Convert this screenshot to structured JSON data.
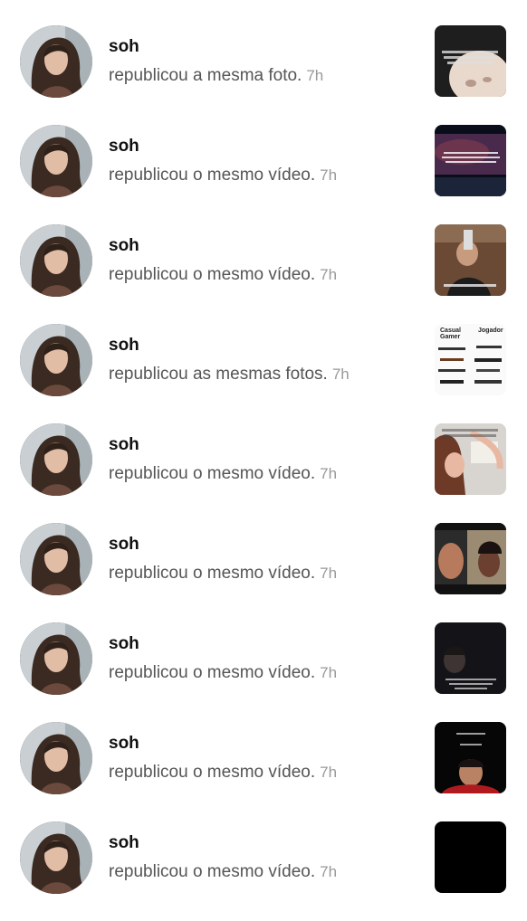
{
  "notifications": [
    {
      "username": "soh",
      "action": "republicou a mesma foto.",
      "time": "7h",
      "thumb": "baby-face"
    },
    {
      "username": "soh",
      "action": "republicou o mesmo vídeo.",
      "time": "7h",
      "thumb": "space-night"
    },
    {
      "username": "soh",
      "action": "republicou o mesmo vídeo.",
      "time": "7h",
      "thumb": "girl-mirror"
    },
    {
      "username": "soh",
      "action": "republicou as mesmas fotos.",
      "time": "7h",
      "thumb": "weapons-chart"
    },
    {
      "username": "soh",
      "action": "republicou o mesmo vídeo.",
      "time": "7h",
      "thumb": "girl-smile"
    },
    {
      "username": "soh",
      "action": "republicou o mesmo vídeo.",
      "time": "7h",
      "thumb": "two-people"
    },
    {
      "username": "soh",
      "action": "republicou o mesmo vídeo.",
      "time": "7h",
      "thumb": "dark-selfie"
    },
    {
      "username": "soh",
      "action": "republicou o mesmo vídeo.",
      "time": "7h",
      "thumb": "dark-boy"
    },
    {
      "username": "soh",
      "action": "republicou o mesmo vídeo.",
      "time": "7h",
      "thumb": "black"
    }
  ],
  "thumb_text": {
    "weapons_left": "Casual",
    "weapons_left2": "Gamer",
    "weapons_right": "Jogador"
  }
}
